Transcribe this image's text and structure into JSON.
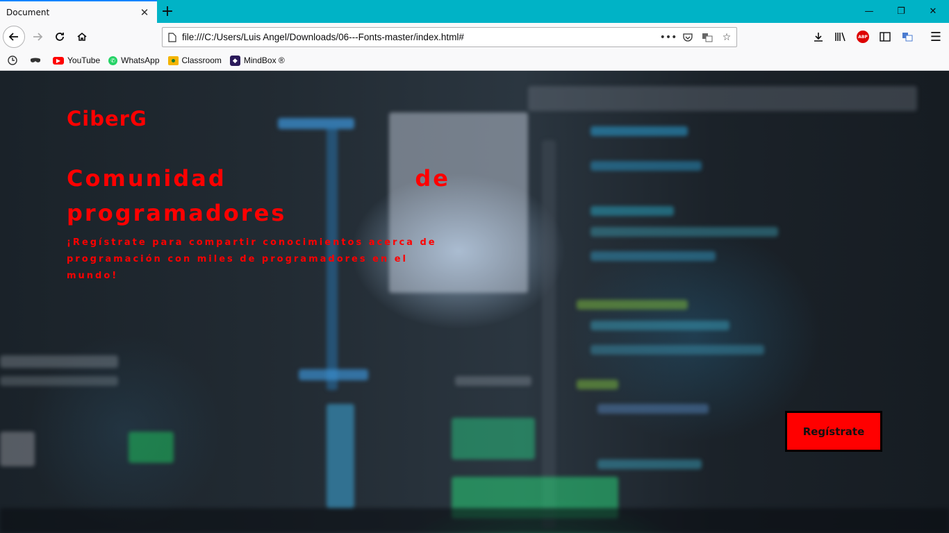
{
  "browser": {
    "tab_title": "Document",
    "url": "file:///C:/Users/Luis Angel/Downloads/06---Fonts-master/index.html#",
    "bookmarks": [
      {
        "label": "",
        "icon": "clock-icon"
      },
      {
        "label": "",
        "icon": "mask-icon"
      },
      {
        "label": "YouTube",
        "icon": "youtube-icon",
        "color": "#ff0000"
      },
      {
        "label": "WhatsApp",
        "icon": "whatsapp-icon",
        "color": "#25d366"
      },
      {
        "label": "Classroom",
        "icon": "classroom-icon",
        "color": "#f4b400"
      },
      {
        "label": "MindBox ®",
        "icon": "mindbox-icon",
        "color": "#2b1a5a"
      }
    ]
  },
  "page": {
    "brand": "CiberG",
    "headline": "Comunidad de programadores",
    "subtitle": "¡Regístrate para compartir conocimientos acerca de programación con miles de programadores en el mundo!",
    "cta_label": "Regístrate",
    "accent_color": "#ff0000"
  }
}
